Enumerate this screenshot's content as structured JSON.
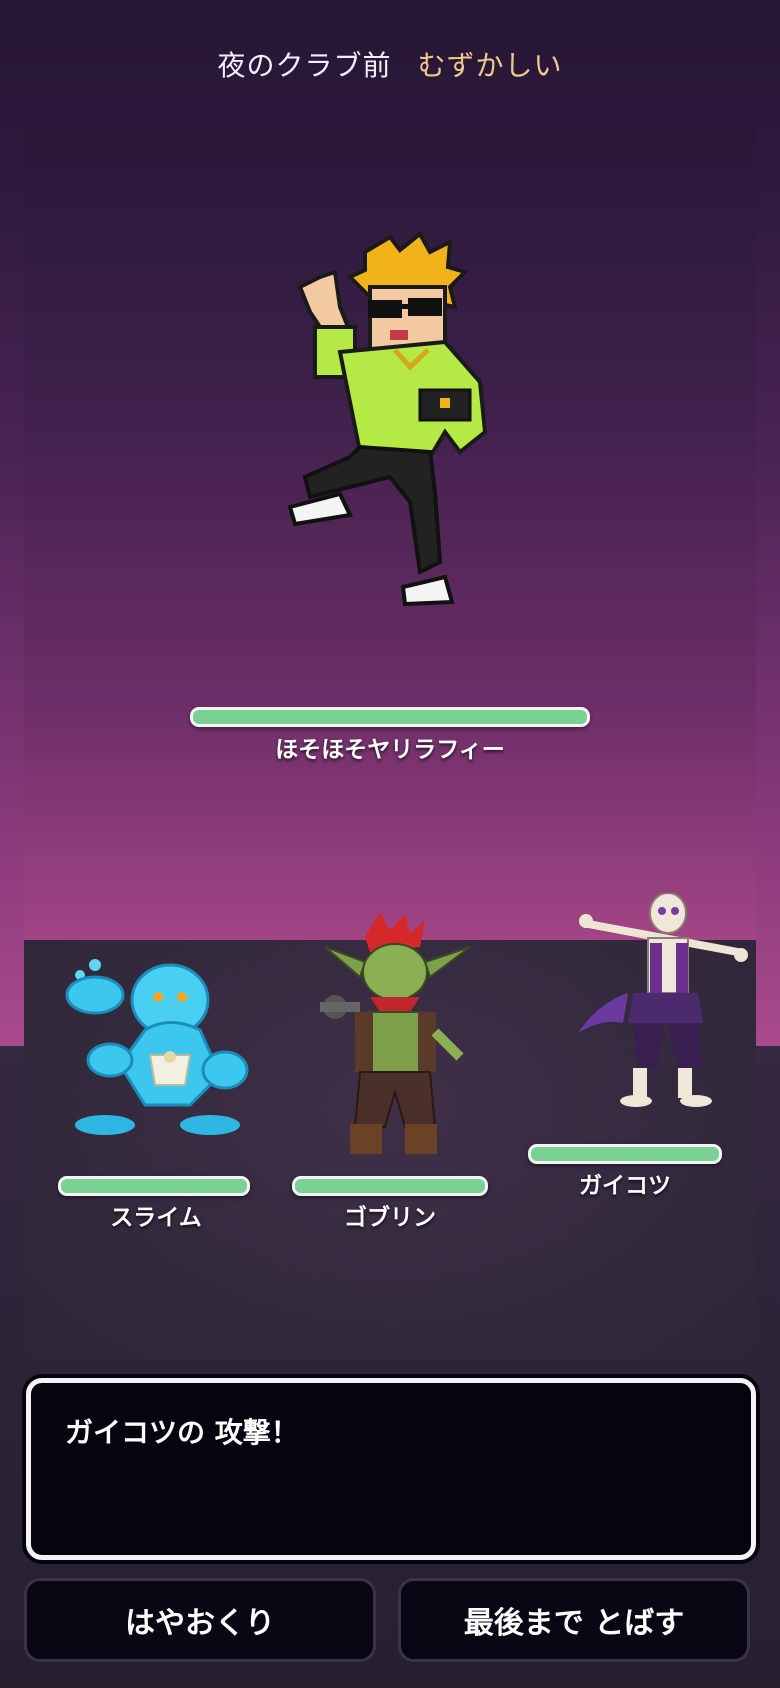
{
  "header": {
    "location": "夜のクラブ前",
    "difficulty": "むずかしい"
  },
  "boss": {
    "name": "ほそほそヤリラフィー",
    "hp_fraction": 1.0
  },
  "party": [
    {
      "name": "スライム",
      "hp_fraction": 1.0
    },
    {
      "name": "ゴブリン",
      "hp_fraction": 1.0
    },
    {
      "name": "ガイコツ",
      "hp_fraction": 1.0
    }
  ],
  "message": {
    "text": "ガイコツの 攻撃！"
  },
  "buttons": {
    "fast_forward": "はやおくり",
    "skip_to_end": "最後まで とばす"
  },
  "icons": [
    "boss-dancer-sprite",
    "slime-sprite",
    "goblin-sprite",
    "skeleton-sprite"
  ],
  "colors": {
    "hp": "#79d293",
    "difficulty": "#f1c98a"
  }
}
